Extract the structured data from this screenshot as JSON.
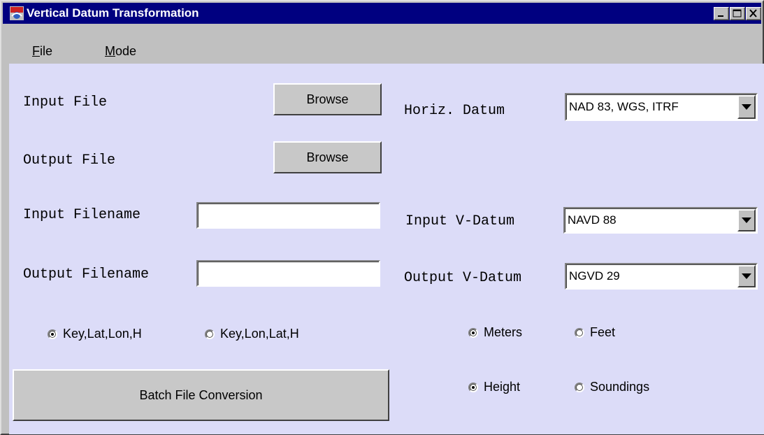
{
  "window": {
    "title": "Vertical Datum Transformation",
    "icon": "app-icon",
    "controls": [
      "minimize-icon",
      "maximize-icon",
      "close-icon"
    ]
  },
  "menu": {
    "file": {
      "mnemonic": "F",
      "rest": "ile"
    },
    "mode": {
      "mnemonic": "M",
      "rest": "ode"
    }
  },
  "left": {
    "input_file_label": "Input File",
    "output_file_label": "Output File",
    "browse_input_label": "Browse",
    "browse_output_label": "Browse",
    "input_filename_label": "Input Filename",
    "input_filename_value": "",
    "output_filename_label": "Output Filename",
    "output_filename_value": "",
    "order_options": [
      {
        "label": "Key,Lat,Lon,H",
        "selected": true
      },
      {
        "label": "Key,Lon,Lat,H",
        "selected": false
      }
    ],
    "batch_button_label": "Batch File Conversion"
  },
  "right": {
    "horiz_datum_label": "Horiz. Datum",
    "horiz_datum_value": "NAD 83, WGS, ITRF",
    "input_vdatum_label": "Input V-Datum",
    "input_vdatum_value": "NAVD 88",
    "output_vdatum_label": "Output V-Datum",
    "output_vdatum_value": "NGVD 29",
    "unit_options": [
      {
        "label": "Meters",
        "selected": true
      },
      {
        "label": "Feet",
        "selected": false
      }
    ],
    "type_options": [
      {
        "label": "Height",
        "selected": true
      },
      {
        "label": "Soundings",
        "selected": false
      }
    ]
  },
  "colors": {
    "titlebar": "#000080",
    "panel_background": "#dcdcf8",
    "chrome": "#c0c0c0"
  }
}
